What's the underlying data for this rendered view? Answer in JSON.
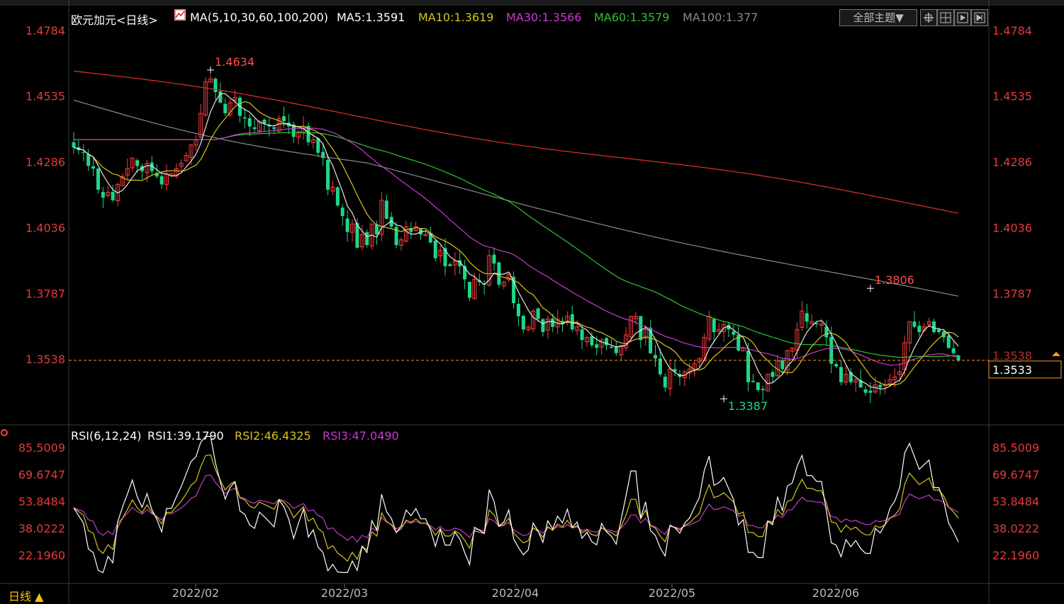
{
  "colors": {
    "up": "#ff3b3b",
    "down": "#1fd68a",
    "ma5": "#e6e6e6",
    "ma10": "#d7c51a",
    "ma30": "#c83ad0",
    "ma60": "#2ec32e",
    "ma100": "#8a8a8a",
    "ma200": "#e0302e",
    "axis_text": "#e23b3b",
    "rsi1": "#ffffff",
    "rsi2": "#d7c51a",
    "rsi3": "#c83ad0",
    "price_line": "#ff9a1a"
  },
  "header": {
    "symbol": "欧元加元<日线>",
    "ma_label": "MA(5,10,30,60,100,200)",
    "ma5": "MA5:1.3591",
    "ma10": "MA10:1.3619",
    "ma30": "MA30:1.3566",
    "ma60": "MA60:1.3579",
    "ma100": "MA100:1.377",
    "theme_button": "全部主题▼",
    "icons": [
      "crosshair-icon",
      "grid-icon",
      "play-icon",
      "next-icon"
    ]
  },
  "rsi_header": {
    "label": "RSI(6,12,24)",
    "rsi1": "RSI1:39.1790",
    "rsi2": "RSI2:46.4325",
    "rsi3": "RSI3:47.0490"
  },
  "footer": {
    "period_label": "日线 ▲"
  },
  "chart_data": [
    {
      "type": "candlestick",
      "y_ticks": [
        "1.4784",
        "1.4535",
        "1.4286",
        "1.4036",
        "1.3787",
        "1.3538"
      ],
      "ylim": [
        1.3538,
        1.4784
      ],
      "x_ticks": [
        "2022/02",
        "2022/03",
        "2022/04",
        "2022/05",
        "2022/06"
      ],
      "current_price": "1.3533",
      "annotations": [
        {
          "label": "1.4634",
          "bar": 28,
          "value": 1.4634
        },
        {
          "label": "1.3806",
          "bar": 163,
          "value": 1.3806
        },
        {
          "label": "1.3387",
          "bar": 133,
          "value": 1.3387
        }
      ],
      "closes": [
        1.434,
        1.433,
        1.432,
        1.427,
        1.426,
        1.418,
        1.415,
        1.417,
        1.414,
        1.42,
        1.423,
        1.426,
        1.43,
        1.427,
        1.425,
        1.428,
        1.425,
        1.423,
        1.42,
        1.424,
        1.424,
        1.426,
        1.428,
        1.431,
        1.435,
        1.437,
        1.447,
        1.459,
        1.46,
        1.455,
        1.451,
        1.447,
        1.451,
        1.453,
        1.446,
        1.445,
        1.442,
        1.441,
        1.444,
        1.443,
        1.442,
        1.441,
        1.445,
        1.444,
        1.442,
        1.438,
        1.44,
        1.442,
        1.436,
        1.437,
        1.432,
        1.43,
        1.418,
        1.419,
        1.412,
        1.408,
        1.402,
        1.405,
        1.396,
        1.401,
        1.397,
        1.405,
        1.401,
        1.414,
        1.407,
        1.404,
        1.397,
        1.399,
        1.404,
        1.402,
        1.404,
        1.401,
        1.401,
        1.398,
        1.392,
        1.395,
        1.389,
        1.389,
        1.391,
        1.389,
        1.384,
        1.377,
        1.384,
        1.383,
        1.382,
        1.393,
        1.39,
        1.382,
        1.383,
        1.386,
        1.375,
        1.37,
        1.365,
        1.366,
        1.372,
        1.369,
        1.364,
        1.369,
        1.366,
        1.369,
        1.367,
        1.37,
        1.365,
        1.366,
        1.361,
        1.362,
        1.359,
        1.358,
        1.361,
        1.359,
        1.358,
        1.356,
        1.359,
        1.363,
        1.37,
        1.37,
        1.361,
        1.365,
        1.356,
        1.354,
        1.348,
        1.343,
        1.35,
        1.349,
        1.347,
        1.349,
        1.35,
        1.352,
        1.354,
        1.362,
        1.37,
        1.364,
        1.365,
        1.367,
        1.365,
        1.363,
        1.357,
        1.358,
        1.345,
        1.345,
        1.342,
        1.342,
        1.348,
        1.347,
        1.353,
        1.35,
        1.357,
        1.358,
        1.365,
        1.372,
        1.368,
        1.368,
        1.367,
        1.367,
        1.362,
        1.352,
        1.351,
        1.345,
        1.348,
        1.345,
        1.346,
        1.343,
        1.341,
        1.341,
        1.344,
        1.343,
        1.344,
        1.346,
        1.347,
        1.349,
        1.36,
        1.368,
        1.366,
        1.364,
        1.366,
        1.368,
        1.364,
        1.364,
        1.362,
        1.358,
        1.356,
        1.3533
      ],
      "ma200_endpoints": [
        1.463,
        1.41
      ],
      "ma100_endpoints": [
        1.452,
        1.376
      ]
    },
    {
      "type": "line",
      "title": "RSI(6,12,24)",
      "y_ticks": [
        "85.5009",
        "69.6747",
        "53.8484",
        "38.0222",
        "22.1960"
      ],
      "ylim": [
        22.196,
        85.5009
      ],
      "series": [
        {
          "name": "RSI1",
          "end_value": 39.179
        },
        {
          "name": "RSI2",
          "end_value": 46.4325
        },
        {
          "name": "RSI3",
          "end_value": 47.049
        }
      ]
    }
  ]
}
